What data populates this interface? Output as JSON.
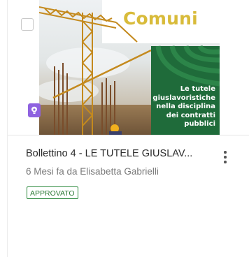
{
  "card": {
    "cover": {
      "title_word": "Comuni",
      "top_fragment": "&",
      "caption": "Le tutele giuslavoristiche nella disciplina dei contratti pubblici",
      "accent_green": "#1f6b3a",
      "accent_yellow": "#d8bb3a"
    },
    "type_icon": "bulb-icon",
    "title": "Bollettino 4 - LE TUTELE GIUSLAV...",
    "meta": "6 Mesi fa da Elisabetta Gabrielli",
    "status": "APPROVATO",
    "status_color": "#2d8a3e",
    "menu_icon": "kebab-menu-icon"
  }
}
